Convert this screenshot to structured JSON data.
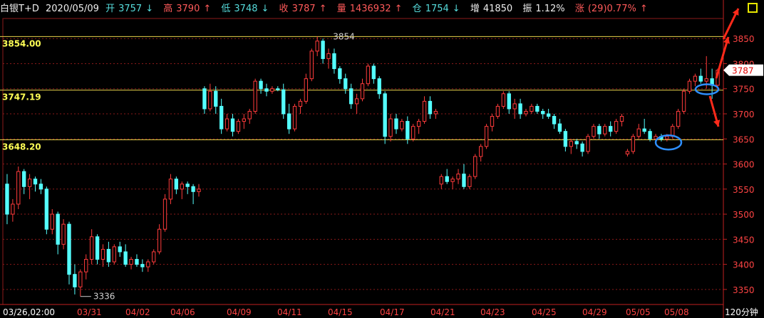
{
  "header": {
    "instrument": "白银T+D",
    "date": "2020/05/09",
    "open_label": "开",
    "open_value": "3757",
    "open_arrow": "↓",
    "high_label": "高",
    "high_value": "3790",
    "high_arrow": "↑",
    "low_label": "低",
    "low_value": "3748",
    "low_arrow": "↓",
    "close_label": "收",
    "close_value": "3787",
    "close_arrow": "↑",
    "volume_label": "量",
    "volume_value": "1436932",
    "volume_arrow": "↑",
    "position_label": "仓",
    "position_value": "1754",
    "position_arrow": "↓",
    "increase_label": "增",
    "increase_value": "41850",
    "amplitude_label": "振",
    "amplitude_value": "1.12%",
    "change_label": "涨",
    "change_value": "(29)0.77%",
    "change_arrow": "↑"
  },
  "colors": {
    "up": "#ff3b3b",
    "down": "#54ffff",
    "level_line": "#e8d24a",
    "grid": "#8b1a1a",
    "axis_text": "#ff4444",
    "level_text": "#ffff55",
    "annotation_arrow": "#ff2a1a",
    "annotation_ellipse": "#2e8fff"
  },
  "chart_data": {
    "type": "candlestick",
    "period": "120分钟",
    "ylim": [
      3320,
      3890
    ],
    "y_ticks": [
      3350,
      3400,
      3450,
      3500,
      3550,
      3600,
      3650,
      3700,
      3750,
      3800,
      3850
    ],
    "x_labels": [
      "03/26,02:00",
      "03/31",
      "04/02",
      "04/06",
      "04/09",
      "04/11",
      "04/15",
      "04/17",
      "04/21",
      "04/23",
      "04/25",
      "04/29",
      "05/05",
      "05/08"
    ],
    "last_price": "3787",
    "levels": [
      {
        "value": 3854.0,
        "label": "3854.00"
      },
      {
        "value": 3747.19,
        "label": "3747.19"
      },
      {
        "value": 3648.2,
        "label": "3648.20"
      }
    ],
    "peak_marker": {
      "value": 3854,
      "label": "3854"
    },
    "low_marker": {
      "value": 3336,
      "label": "3336"
    },
    "candles": [
      [
        3560,
        3580,
        3480,
        3500
      ],
      [
        3500,
        3530,
        3485,
        3520
      ],
      [
        3520,
        3595,
        3510,
        3585
      ],
      [
        3585,
        3590,
        3540,
        3555
      ],
      [
        3555,
        3580,
        3530,
        3570
      ],
      [
        3570,
        3575,
        3545,
        3560
      ],
      [
        3560,
        3570,
        3540,
        3550
      ],
      [
        3550,
        3555,
        3460,
        3470
      ],
      [
        3470,
        3510,
        3460,
        3500
      ],
      [
        3500,
        3505,
        3420,
        3440
      ],
      [
        3440,
        3490,
        3430,
        3480
      ],
      [
        3480,
        3485,
        3360,
        3380
      ],
      [
        3380,
        3400,
        3340,
        3355
      ],
      [
        3355,
        3390,
        3336,
        3385
      ],
      [
        3385,
        3420,
        3370,
        3410
      ],
      [
        3410,
        3470,
        3400,
        3455
      ],
      [
        3455,
        3460,
        3400,
        3410
      ],
      [
        3410,
        3440,
        3395,
        3430
      ],
      [
        3430,
        3445,
        3395,
        3405
      ],
      [
        3405,
        3440,
        3400,
        3435
      ],
      [
        3435,
        3445,
        3415,
        3425
      ],
      [
        3425,
        3440,
        3395,
        3400
      ],
      [
        3400,
        3415,
        3390,
        3410
      ],
      [
        3410,
        3420,
        3395,
        3400
      ],
      [
        3400,
        3410,
        3385,
        3395
      ],
      [
        3395,
        3410,
        3385,
        3405
      ],
      [
        3405,
        3430,
        3400,
        3425
      ],
      [
        3425,
        3480,
        3420,
        3470
      ],
      [
        3470,
        3540,
        3465,
        3530
      ],
      [
        3530,
        3580,
        3520,
        3570
      ],
      [
        3570,
        3575,
        3540,
        3550
      ],
      [
        3550,
        3565,
        3530,
        3560
      ],
      [
        3560,
        3565,
        3540,
        3555
      ],
      [
        3555,
        3560,
        3520,
        3545
      ],
      [
        3545,
        3560,
        3535,
        3550
      ],
      [
        3750,
        3755,
        3700,
        3710
      ],
      [
        3710,
        3760,
        3705,
        3745
      ],
      [
        3745,
        3755,
        3700,
        3715
      ],
      [
        3715,
        3730,
        3660,
        3670
      ],
      [
        3670,
        3700,
        3665,
        3690
      ],
      [
        3690,
        3700,
        3655,
        3665
      ],
      [
        3665,
        3690,
        3660,
        3685
      ],
      [
        3685,
        3700,
        3670,
        3690
      ],
      [
        3690,
        3710,
        3680,
        3705
      ],
      [
        3705,
        3770,
        3700,
        3765
      ],
      [
        3765,
        3770,
        3740,
        3750
      ],
      [
        3750,
        3760,
        3735,
        3745
      ],
      [
        3745,
        3755,
        3740,
        3750
      ],
      [
        3750,
        3755,
        3745,
        3748
      ],
      [
        3748,
        3760,
        3690,
        3700
      ],
      [
        3700,
        3720,
        3660,
        3670
      ],
      [
        3670,
        3720,
        3665,
        3715
      ],
      [
        3715,
        3730,
        3700,
        3725
      ],
      [
        3725,
        3780,
        3720,
        3770
      ],
      [
        3770,
        3830,
        3765,
        3825
      ],
      [
        3825,
        3854,
        3815,
        3845
      ],
      [
        3845,
        3850,
        3800,
        3810
      ],
      [
        3810,
        3830,
        3790,
        3820
      ],
      [
        3820,
        3830,
        3780,
        3790
      ],
      [
        3790,
        3795,
        3760,
        3770
      ],
      [
        3770,
        3780,
        3740,
        3750
      ],
      [
        3750,
        3760,
        3710,
        3720
      ],
      [
        3720,
        3740,
        3700,
        3730
      ],
      [
        3730,
        3770,
        3725,
        3760
      ],
      [
        3760,
        3800,
        3755,
        3795
      ],
      [
        3795,
        3800,
        3760,
        3770
      ],
      [
        3770,
        3775,
        3730,
        3740
      ],
      [
        3740,
        3745,
        3640,
        3655
      ],
      [
        3655,
        3700,
        3645,
        3690
      ],
      [
        3690,
        3700,
        3660,
        3670
      ],
      [
        3670,
        3690,
        3665,
        3685
      ],
      [
        3685,
        3695,
        3640,
        3650
      ],
      [
        3650,
        3680,
        3645,
        3675
      ],
      [
        3675,
        3690,
        3660,
        3685
      ],
      [
        3685,
        3735,
        3680,
        3725
      ],
      [
        3725,
        3735,
        3690,
        3700
      ],
      [
        3700,
        3710,
        3690,
        3705
      ],
      [
        3560,
        3580,
        3550,
        3575
      ],
      [
        3575,
        3590,
        3560,
        3565
      ],
      [
        3565,
        3575,
        3550,
        3570
      ],
      [
        3570,
        3590,
        3560,
        3580
      ],
      [
        3580,
        3600,
        3550,
        3555
      ],
      [
        3555,
        3580,
        3550,
        3575
      ],
      [
        3575,
        3620,
        3570,
        3615
      ],
      [
        3615,
        3640,
        3605,
        3635
      ],
      [
        3635,
        3680,
        3630,
        3675
      ],
      [
        3675,
        3700,
        3665,
        3695
      ],
      [
        3695,
        3720,
        3690,
        3715
      ],
      [
        3715,
        3745,
        3710,
        3740
      ],
      [
        3740,
        3745,
        3700,
        3710
      ],
      [
        3710,
        3730,
        3690,
        3720
      ],
      [
        3720,
        3730,
        3690,
        3700
      ],
      [
        3700,
        3710,
        3695,
        3705
      ],
      [
        3705,
        3720,
        3700,
        3715
      ],
      [
        3715,
        3720,
        3700,
        3705
      ],
      [
        3705,
        3710,
        3690,
        3700
      ],
      [
        3700,
        3710,
        3690,
        3695
      ],
      [
        3695,
        3700,
        3670,
        3680
      ],
      [
        3680,
        3690,
        3660,
        3665
      ],
      [
        3665,
        3670,
        3625,
        3635
      ],
      [
        3635,
        3650,
        3620,
        3645
      ],
      [
        3645,
        3650,
        3630,
        3640
      ],
      [
        3640,
        3645,
        3615,
        3625
      ],
      [
        3625,
        3660,
        3620,
        3655
      ],
      [
        3655,
        3680,
        3650,
        3675
      ],
      [
        3675,
        3680,
        3650,
        3660
      ],
      [
        3660,
        3680,
        3655,
        3675
      ],
      [
        3675,
        3685,
        3655,
        3665
      ],
      [
        3665,
        3690,
        3660,
        3685
      ],
      [
        3685,
        3700,
        3675,
        3695
      ],
      [
        3620,
        3630,
        3615,
        3625
      ],
      [
        3625,
        3660,
        3620,
        3655
      ],
      [
        3655,
        3680,
        3650,
        3670
      ],
      [
        3670,
        3690,
        3660,
        3665
      ],
      [
        3665,
        3670,
        3645,
        3650
      ],
      [
        3650,
        3660,
        3645,
        3655
      ],
      [
        3655,
        3660,
        3645,
        3650
      ],
      [
        3650,
        3660,
        3645,
        3655
      ],
      [
        3655,
        3680,
        3650,
        3675
      ],
      [
        3675,
        3710,
        3670,
        3705
      ],
      [
        3705,
        3750,
        3700,
        3745
      ],
      [
        3745,
        3770,
        3740,
        3765
      ],
      [
        3765,
        3780,
        3755,
        3775
      ],
      [
        3775,
        3790,
        3760,
        3765
      ],
      [
        3765,
        3815,
        3750,
        3770
      ],
      [
        3770,
        3790,
        3730,
        3757
      ],
      [
        3757,
        3790,
        3748,
        3787
      ]
    ]
  }
}
